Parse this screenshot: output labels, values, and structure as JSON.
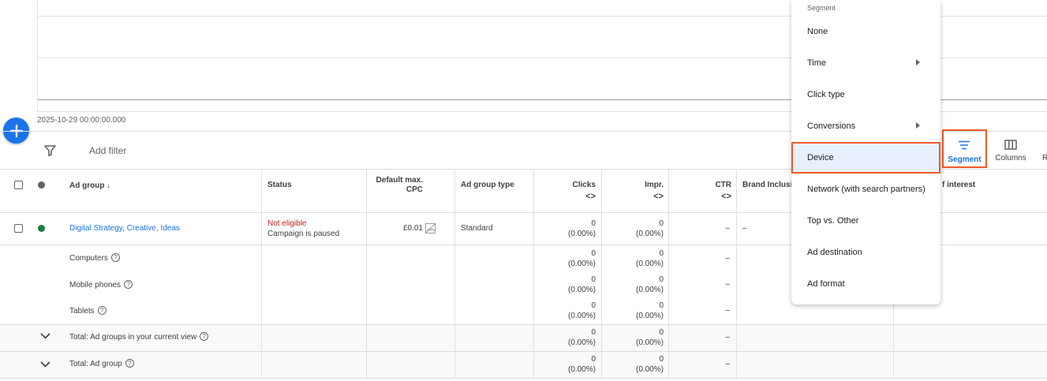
{
  "chart": {
    "timestamp": "2025-10-29 00:00:00.000"
  },
  "toolbar": {
    "add_filter": "Add filter",
    "segment_label": "Segment",
    "columns_label": "Columns",
    "more_label": "R"
  },
  "table": {
    "headers": {
      "ad_group": "Ad group",
      "status": "Status",
      "default_cpc_1": "Default max.",
      "default_cpc_2": "CPC",
      "ad_group_type": "Ad group type",
      "clicks": "Clicks",
      "impr": "Impr.",
      "ctr": "CTR",
      "brand_inclusion": "Brand Inclusio",
      "interest": "f interest"
    },
    "row": {
      "name": "Digital Strategy, Creative, Ideas",
      "status_main": "Not eligible",
      "status_sub": "Campaign is paused",
      "cpc": "£0.01",
      "type": "Standard",
      "clicks": "0",
      "clicks_pct": "(0.00%)",
      "impr": "0",
      "impr_pct": "(0.00%)",
      "ctr": "–",
      "brand": "–"
    },
    "segments": [
      {
        "label": "Computers",
        "clicks": "0",
        "clicks_pct": "(0.00%)",
        "impr": "0",
        "impr_pct": "(0.00%)",
        "ctr": "–"
      },
      {
        "label": "Mobile phones",
        "clicks": "0",
        "clicks_pct": "(0.00%)",
        "impr": "0",
        "impr_pct": "(0.00%)",
        "ctr": "–"
      },
      {
        "label": "Tablets",
        "clicks": "0",
        "clicks_pct": "(0.00%)",
        "impr": "0",
        "impr_pct": "(0.00%)",
        "ctr": "–"
      }
    ],
    "totals": [
      {
        "label": "Total: Ad groups in your current view",
        "clicks": "0",
        "clicks_pct": "(0.00%)",
        "impr": "0",
        "impr_pct": "(0.00%)",
        "ctr": "–"
      },
      {
        "label": "Total: Ad group",
        "clicks": "0",
        "clicks_pct": "(0.00%)",
        "impr": "0",
        "impr_pct": "(0.00%)",
        "ctr": "–"
      }
    ]
  },
  "menu": {
    "title": "Segment",
    "items": [
      "None",
      "Time",
      "Click type",
      "Conversions",
      "Device",
      "Network (with search partners)",
      "Top vs. Other",
      "Ad destination",
      "Ad format"
    ]
  },
  "colors": {
    "accent": "#1a73e8",
    "highlight": "#f05a28",
    "status_error": "#c5221f",
    "status_ok": "#188038"
  }
}
